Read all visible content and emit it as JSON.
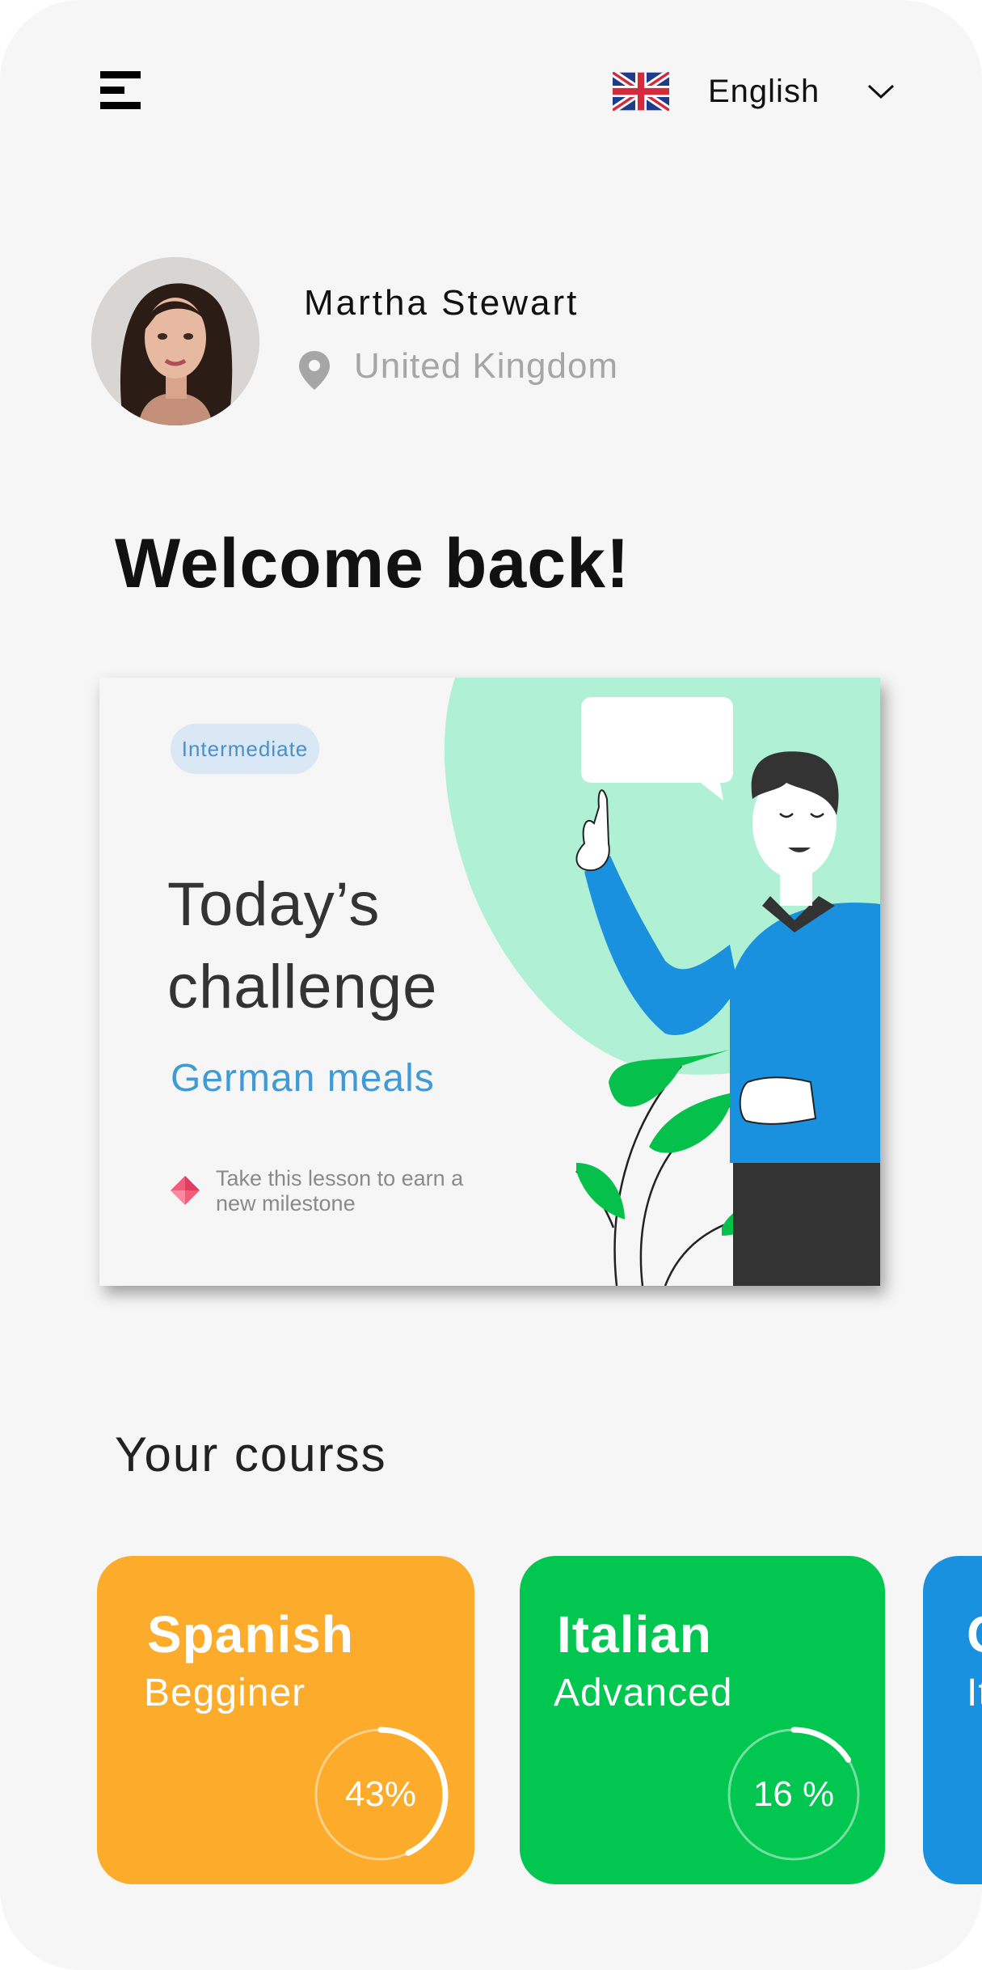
{
  "header": {
    "language": "English",
    "icons": {
      "menu": "hamburger-menu-icon",
      "flag": "uk-flag-icon",
      "dropdown": "chevron-down-icon"
    }
  },
  "profile": {
    "name": "Martha Stewart",
    "location": "United Kingdom",
    "location_icon": "location-pin-icon"
  },
  "welcome": "Welcome back!",
  "challenge": {
    "level": "Intermediate",
    "title": "Today’s challenge",
    "subject": "German meals",
    "note": "Take this lesson to earn a new milestone",
    "note_icon": "gem-icon"
  },
  "courses": {
    "heading": "Your courss",
    "items": [
      {
        "name": "Spanish",
        "level": "Begginer",
        "progress": 43,
        "progress_label": "43%",
        "color": "#fcab2b"
      },
      {
        "name": "Italian",
        "level": "Advanced",
        "progress": 16,
        "progress_label": "16 %",
        "color": "#01c650"
      },
      {
        "name": "G",
        "level": "It",
        "color": "#1991de"
      }
    ]
  },
  "colors": {
    "background": "#f6f6f6",
    "accent_blue": "#3f9ad6",
    "mint": "#b0f0d4",
    "badge_bg": "#d9e8f4"
  }
}
